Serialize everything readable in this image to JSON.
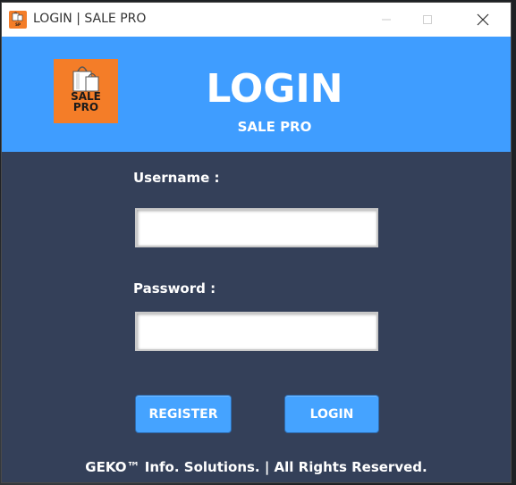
{
  "window": {
    "title": "LOGIN | SALE PRO"
  },
  "header": {
    "logo_line1": "SALE",
    "logo_line2": "PRO",
    "title": "LOGIN",
    "subtitle": "SALE PRO"
  },
  "form": {
    "username_label": "Username :",
    "username_value": "",
    "password_label": "Password :",
    "password_value": ""
  },
  "buttons": {
    "register": "REGISTER",
    "login": "LOGIN"
  },
  "footer": {
    "text": "GEKO™  Info. Solutions.  | All Rights Reserved."
  },
  "colors": {
    "header_bg": "#3f9dff",
    "body_bg": "#344059",
    "logo_bg": "#f47d28",
    "button_bg": "#45a3ff"
  },
  "icons": {
    "app_icon": "shopping-bag-icon",
    "minimize": "minimize-icon",
    "maximize": "maximize-icon",
    "close": "close-icon"
  }
}
